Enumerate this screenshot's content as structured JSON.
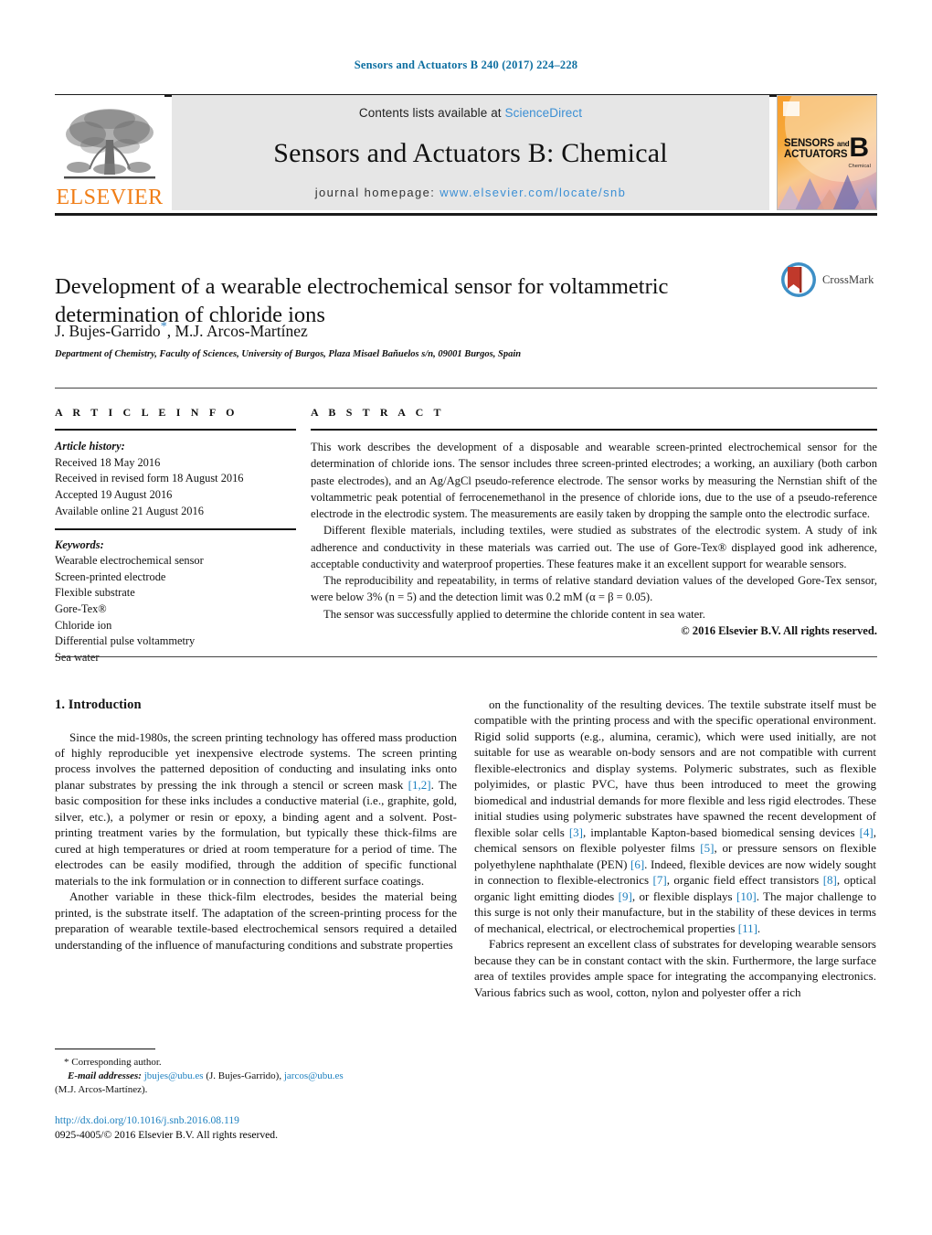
{
  "running_head": "Sensors and Actuators B 240 (2017) 224–228",
  "masthead": {
    "publisher": "ELSEVIER",
    "contents_prefix": "Contents lists available at ",
    "contents_link": "ScienceDirect",
    "journal_title": "Sensors and Actuators B: Chemical",
    "homepage_prefix": "journal homepage: ",
    "homepage_url": "www.elsevier.com/locate/snb",
    "cover": {
      "line1": "SENSORS",
      "line1_small": "and",
      "line2": "ACTUATORS",
      "volume_letter": "B",
      "volume_sub": "Chemical"
    }
  },
  "article": {
    "title": "Development of a wearable electrochemical sensor for voltammetric determination of chloride ions",
    "authors": "J. Bujes-Garrido",
    "authors_rest": ", M.J. Arcos-Martínez",
    "corresponding_marker": "*",
    "affiliation": "Department of Chemistry, Faculty of Sciences, University of Burgos, Plaza Misael Bañuelos s/n, 09001 Burgos, Spain",
    "crossmark_label": "CrossMark"
  },
  "article_info": {
    "heading": "A R T I C L E   I N F O",
    "history_label": "Article history:",
    "history": [
      "Received 18 May 2016",
      "Received in revised form 18 August 2016",
      "Accepted 19 August 2016",
      "Available online 21 August 2016"
    ],
    "keywords_label": "Keywords:",
    "keywords": [
      "Wearable electrochemical sensor",
      "Screen-printed electrode",
      "Flexible substrate",
      "Gore-Tex®",
      "Chloride ion",
      "Differential pulse voltammetry",
      "Sea water"
    ]
  },
  "abstract": {
    "heading": "A B S T R A C T",
    "paragraphs": [
      "This work describes the development of a disposable and wearable screen-printed electrochemical sensor for the determination of chloride ions. The sensor includes three screen-printed electrodes; a working, an auxiliary (both carbon paste electrodes), and an Ag/AgCl pseudo-reference electrode. The sensor works by measuring the Nernstian shift of the voltammetric peak potential of ferrocenemethanol in the presence of chloride ions, due to the use of a pseudo-reference electrode in the electrodic system. The measurements are easily taken by dropping the sample onto the electrodic surface.",
      "Different flexible materials, including textiles, were studied as substrates of the electrodic system. A study of ink adherence and conductivity in these materials was carried out. The use of Gore-Tex® displayed good ink adherence, acceptable conductivity and waterproof properties. These features make it an excellent support for wearable sensors.",
      "The reproducibility and repeatability, in terms of relative standard deviation values of the developed Gore-Tex sensor, were below 3% (n = 5) and the detection limit was 0.2 mM (α = β = 0.05).",
      "The sensor was successfully applied to determine the chloride content in sea water."
    ],
    "copyright": "© 2016 Elsevier B.V. All rights reserved."
  },
  "introduction": {
    "heading": "1.  Introduction",
    "left_paragraphs": [
      "Since the mid-1980s, the screen printing technology has offered mass production of highly reproducible yet inexpensive electrode systems. The screen printing process involves the patterned deposition of conducting and insulating inks onto planar substrates by pressing the ink through a stencil or screen mask [1,2]. The basic composition for these inks includes a conductive material (i.e., graphite, gold, silver, etc.), a polymer or resin or epoxy, a binding agent and a solvent. Post-printing treatment varies by the formulation, but typically these thick-films are cured at high temperatures or dried at room temperature for a period of time. The electrodes can be easily modified, through the addition of specific functional materials to the ink formulation or in connection to different surface coatings.",
      "Another variable in these thick-film electrodes, besides the material being printed, is the substrate itself. The adaptation of the screen-printing process for the preparation of wearable textile-based electrochemical sensors required a detailed understanding of the influence of manufacturing conditions and substrate properties"
    ],
    "right_paragraphs": [
      "on the functionality of the resulting devices. The textile substrate itself must be compatible with the printing process and with the specific operational environment. Rigid solid supports (e.g., alumina, ceramic), which were used initially, are not suitable for use as wearable on-body sensors and are not compatible with current flexible-electronics and display systems. Polymeric substrates, such as flexible polyimides, or plastic PVC, have thus been introduced to meet the growing biomedical and industrial demands for more flexible and less rigid electrodes. These initial studies using polymeric substrates have spawned the recent development of flexible solar cells [3], implantable Kapton-based biomedical sensing devices [4], chemical sensors on flexible polyester films [5], or pressure sensors on flexible polyethylene naphthalate (PEN) [6]. Indeed, flexible devices are now widely sought in connection to flexible-electronics [7], organic field effect transistors [8], optical organic light emitting diodes [9], or flexible displays [10]. The major challenge to this surge is not only their manufacture, but in the stability of these devices in terms of mechanical, electrical, or electrochemical properties [11].",
      "Fabrics represent an excellent class of substrates for developing wearable sensors because they can be in constant contact with the skin. Furthermore, the large surface area of textiles provides ample space for integrating the accompanying electronics. Various fabrics such as wool, cotton, nylon and polyester offer a rich"
    ]
  },
  "footnotes": {
    "corresponding": "* Corresponding author.",
    "email_label": "E-mail addresses:",
    "email1": "jbujes@ubu.es",
    "email1_owner": " (J. Bujes-Garrido), ",
    "email2": "jarcos@ubu.es",
    "email2_owner": "(M.J. Arcos-Martínez).",
    "doi": "http://dx.doi.org/10.1016/j.snb.2016.08.119",
    "issn_copyright": "0925-4005/© 2016 Elsevier B.V. All rights reserved."
  },
  "colors": {
    "link": "#1b7fbf",
    "runhead": "#0c6ea0",
    "elsevier_orange": "#f07d16",
    "band_gray": "#e6e6e6"
  }
}
